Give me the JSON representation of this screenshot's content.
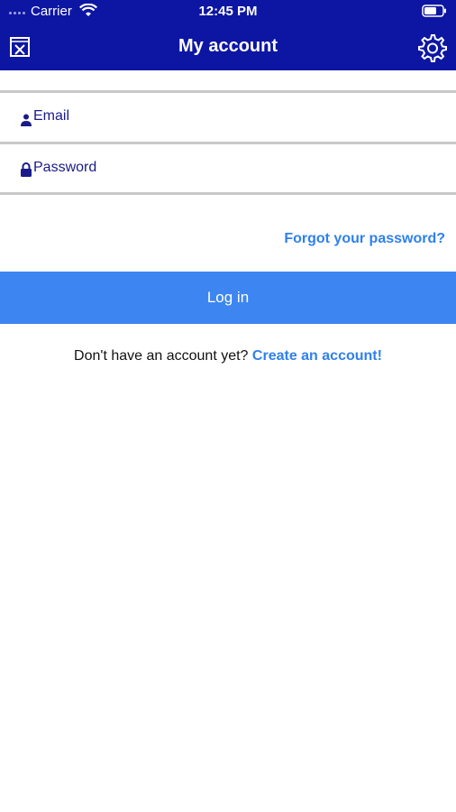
{
  "status_bar": {
    "carrier": "Carrier",
    "time": "12:45 PM"
  },
  "nav": {
    "title": "My account",
    "left_icon": "close-icon",
    "right_icon": "gear-icon"
  },
  "form": {
    "email_placeholder": "Email",
    "email_value": "",
    "password_placeholder": "Password",
    "password_value": "",
    "forgot_label": "Forgot your password?",
    "login_label": "Log in"
  },
  "signup": {
    "prompt": "Don't have an account yet?",
    "link_label": "Create an account!"
  },
  "colors": {
    "header_bg": "#0d16a3",
    "button_bg": "#3d85f0",
    "link": "#2f80ed",
    "field_text": "#1a1a8a"
  }
}
